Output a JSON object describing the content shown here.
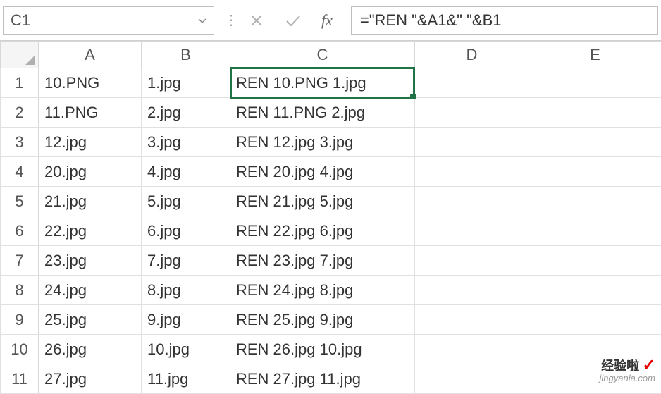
{
  "nameBox": "C1",
  "formula": "=\"REN \"&A1&\" \"&B1",
  "columns": [
    "A",
    "B",
    "C",
    "D",
    "E"
  ],
  "rows": [
    {
      "n": "1",
      "a": "10.PNG",
      "b": "1.jpg",
      "c": "REN 10.PNG 1.jpg",
      "d": "",
      "e": ""
    },
    {
      "n": "2",
      "a": "11.PNG",
      "b": "2.jpg",
      "c": "REN 11.PNG 2.jpg",
      "d": "",
      "e": ""
    },
    {
      "n": "3",
      "a": "12.jpg",
      "b": "3.jpg",
      "c": "REN 12.jpg 3.jpg",
      "d": "",
      "e": ""
    },
    {
      "n": "4",
      "a": "20.jpg",
      "b": "4.jpg",
      "c": "REN 20.jpg 4.jpg",
      "d": "",
      "e": ""
    },
    {
      "n": "5",
      "a": "21.jpg",
      "b": "5.jpg",
      "c": "REN 21.jpg 5.jpg",
      "d": "",
      "e": ""
    },
    {
      "n": "6",
      "a": "22.jpg",
      "b": "6.jpg",
      "c": "REN 22.jpg 6.jpg",
      "d": "",
      "e": ""
    },
    {
      "n": "7",
      "a": "23.jpg",
      "b": "7.jpg",
      "c": "REN 23.jpg 7.jpg",
      "d": "",
      "e": ""
    },
    {
      "n": "8",
      "a": "24.jpg",
      "b": "8.jpg",
      "c": "REN 24.jpg 8.jpg",
      "d": "",
      "e": ""
    },
    {
      "n": "9",
      "a": "25.jpg",
      "b": "9.jpg",
      "c": "REN 25.jpg 9.jpg",
      "d": "",
      "e": ""
    },
    {
      "n": "10",
      "a": "26.jpg",
      "b": "10.jpg",
      "c": "REN 26.jpg 10.jpg",
      "d": "",
      "e": ""
    },
    {
      "n": "11",
      "a": "27.jpg",
      "b": "11.jpg",
      "c": "REN 27.jpg 11.jpg",
      "d": "",
      "e": ""
    }
  ],
  "fxLabel": "fx",
  "watermark": {
    "top": "经验啦",
    "check": "✓",
    "bottom": "jingyanla.com"
  }
}
